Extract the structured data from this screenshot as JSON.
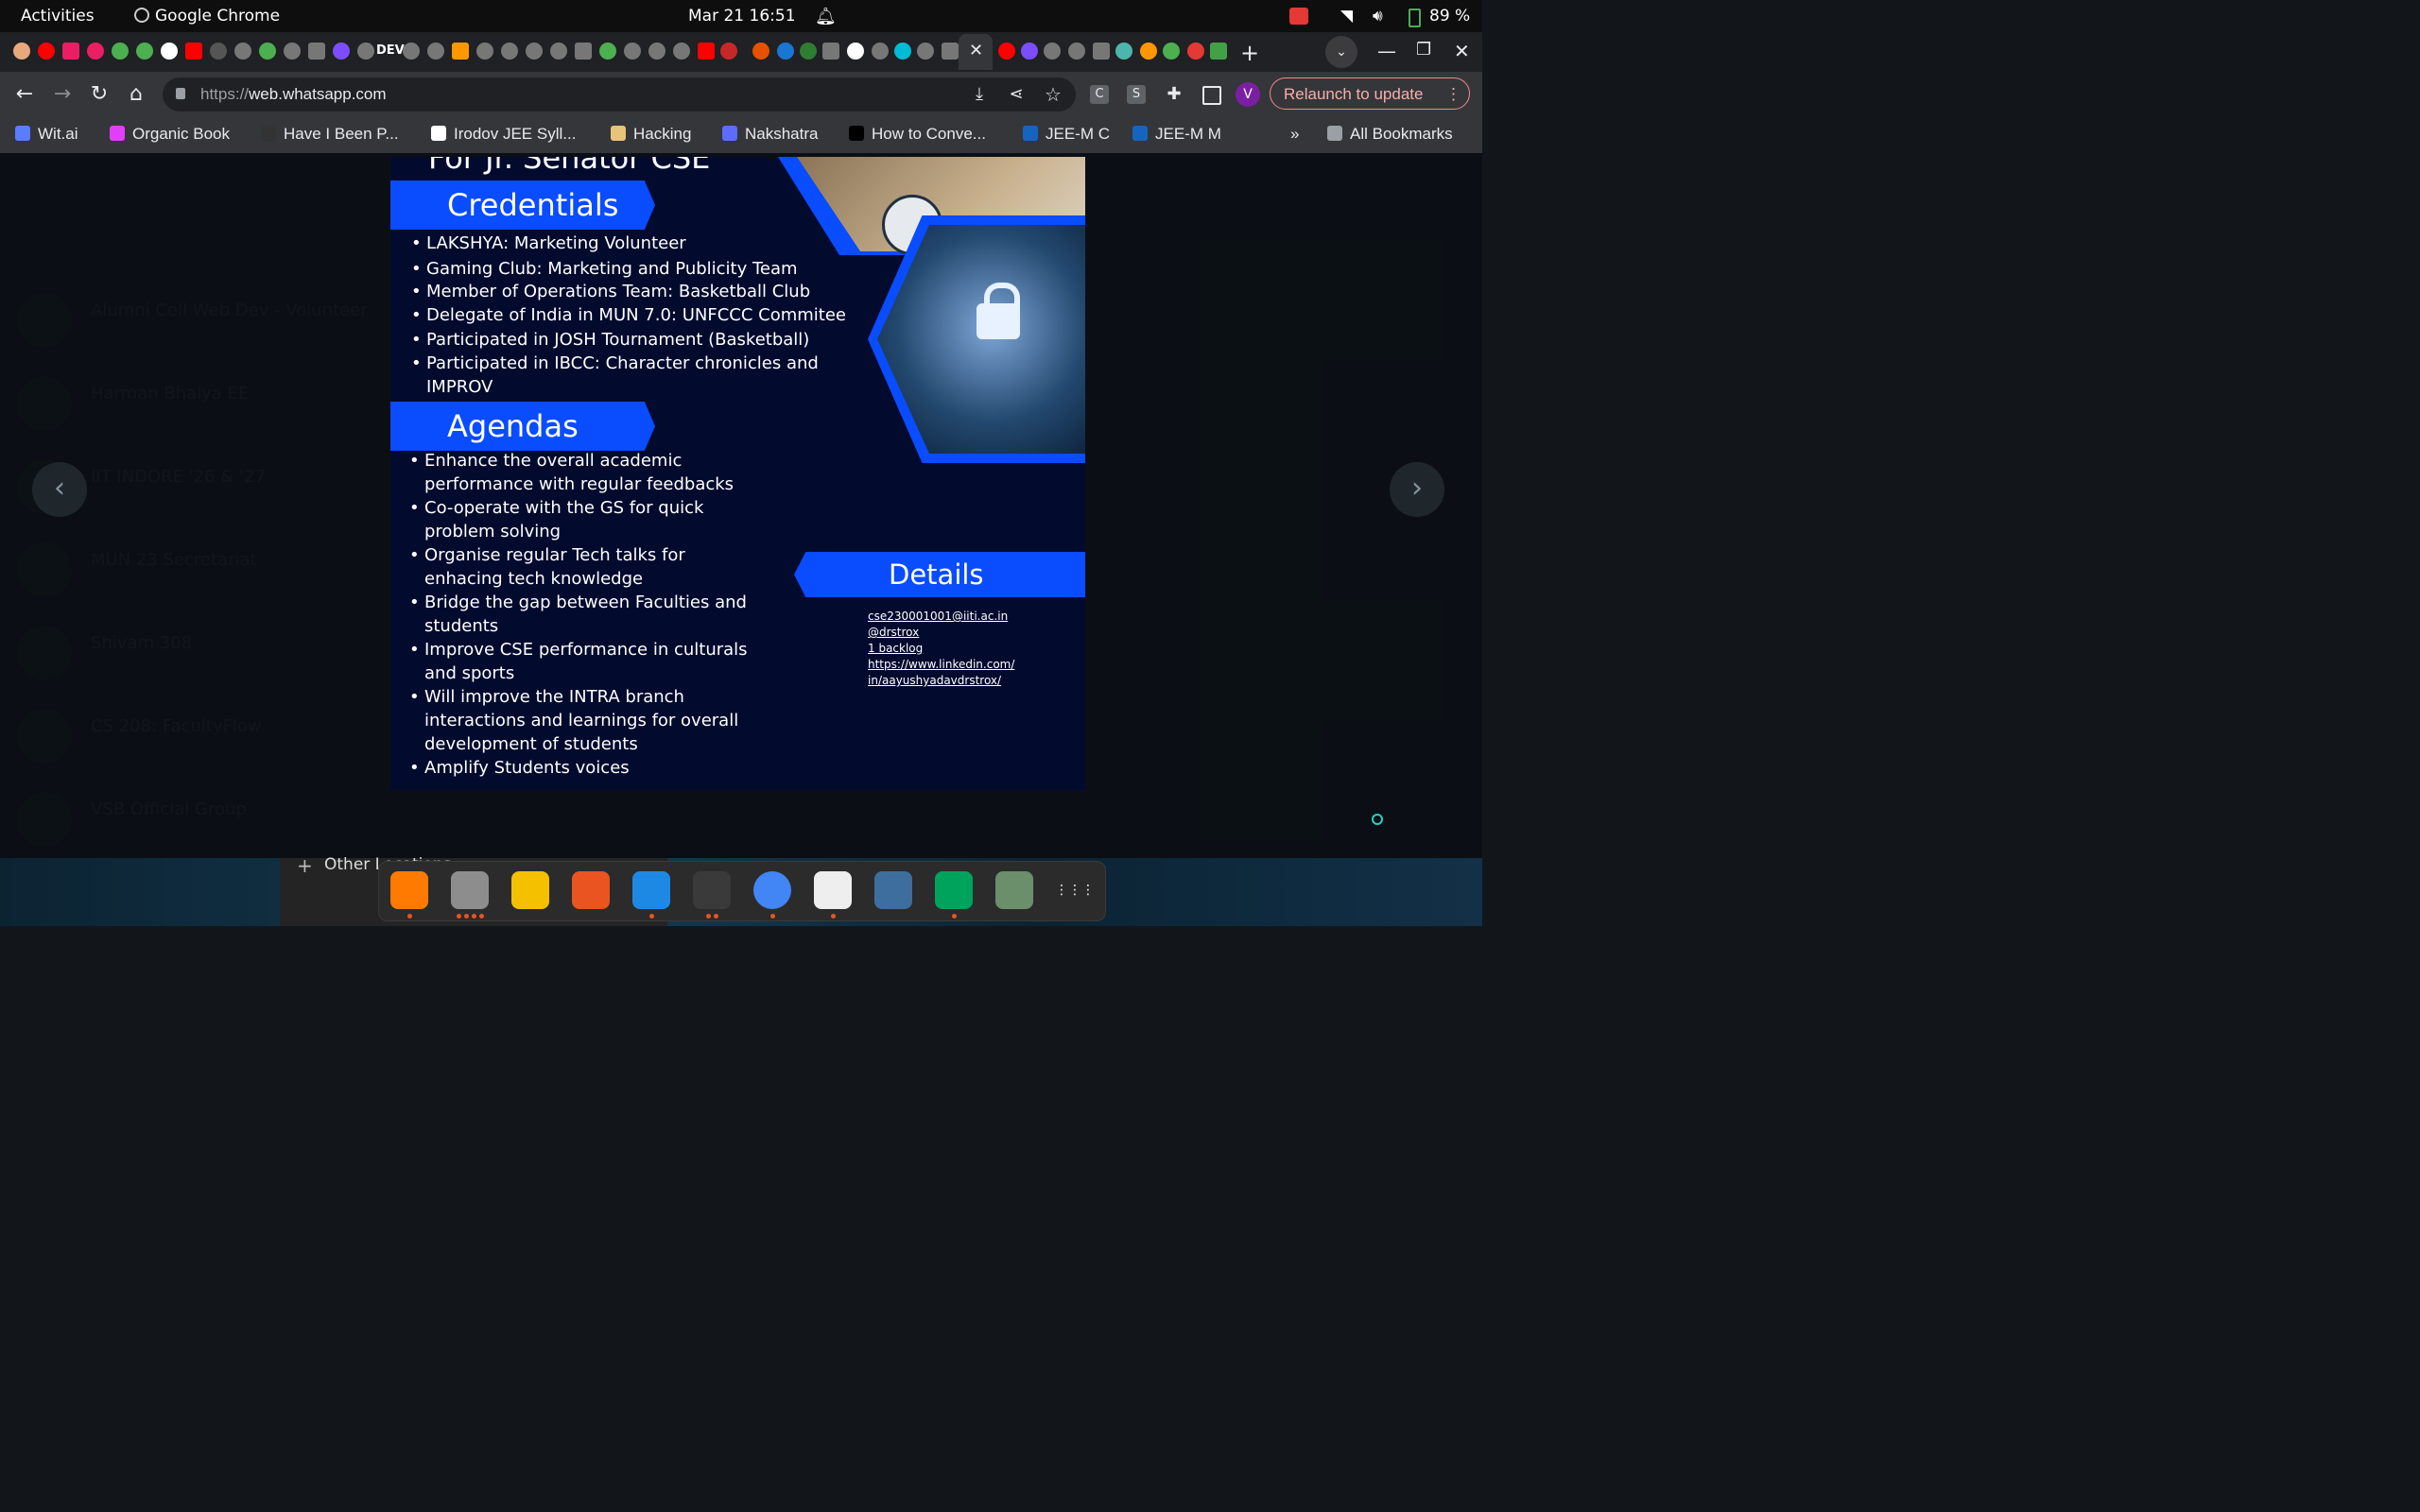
{
  "system_bar": {
    "activities": "Activities",
    "app_name": "Google Chrome",
    "clock": "Mar 21  16:51",
    "battery": "89 %"
  },
  "browser": {
    "url_scheme": "https://",
    "url_host": "web.whatsapp.com",
    "relaunch_label": "Relaunch to update",
    "profile_initial": "V",
    "tab_dev_label": "DEV",
    "ext_c": "C",
    "ext_s": "S"
  },
  "bookmarks": [
    {
      "label": "Wit.ai",
      "color": "#5a7cff"
    },
    {
      "label": "Organic Book",
      "color": "#e040fb"
    },
    {
      "label": "Have I Been P...",
      "color": "#333333"
    },
    {
      "label": "Irodov JEE Syll...",
      "color": "#ffffff"
    },
    {
      "label": "Hacking",
      "color": "#e8c37a"
    },
    {
      "label": "Nakshatra",
      "color": "#5b6cff"
    },
    {
      "label": "How to Conve...",
      "color": "#000000"
    },
    {
      "label": "JEE-M C",
      "color": "#1565c0"
    },
    {
      "label": "JEE-M M",
      "color": "#1565c0"
    }
  ],
  "bookmarks_overflow": "»",
  "all_bookmarks": "All Bookmarks",
  "background_chats": [
    "Alumni Cell Web Dev - Volunteer",
    "Harman Bhaiya EE",
    "IIT INDORE '26 & '27",
    "MUN 23 Secretariat",
    "Shivam 308",
    "CS 208: FacultyFlow",
    "VSB Official Group"
  ],
  "poster": {
    "header_partial": "For Jr. Senator CSE",
    "credentials_title": "Credentials",
    "credentials": [
      "LAKSHYA: Marketing Volunteer",
      "Gaming Club: Marketing and Publicity Team",
      "Member of Operations Team: Basketball Club",
      "Delegate of India in MUN 7.0: UNFCCC Commitee",
      "Participated in JOSH Tournament (Basketball)",
      "Participated in IBCC: Character chronicles and",
      "IMPROV"
    ],
    "agendas_title": "Agendas",
    "agendas": [
      "Enhance the overall academic",
      "performance with regular feedbacks",
      "Co-operate with the GS for quick",
      "problem solving",
      "Organise regular Tech talks for",
      "enhacing tech knowledge",
      "Bridge the gap between Faculties and",
      "students",
      "Improve CSE performance in culturals",
      "and sports",
      "Will improve the INTRA branch",
      "interactions and learnings for overall",
      "development of students",
      "Amplify Students voices"
    ],
    "details_title": "Details",
    "details": [
      "cse230001001@iiti.ac.in",
      "@drstrox",
      "1 backlog",
      "https://www.linkedin.com/",
      "in/aayushyadavdrstrox/"
    ]
  },
  "files_panel": {
    "other_locations": "Other Locations"
  }
}
